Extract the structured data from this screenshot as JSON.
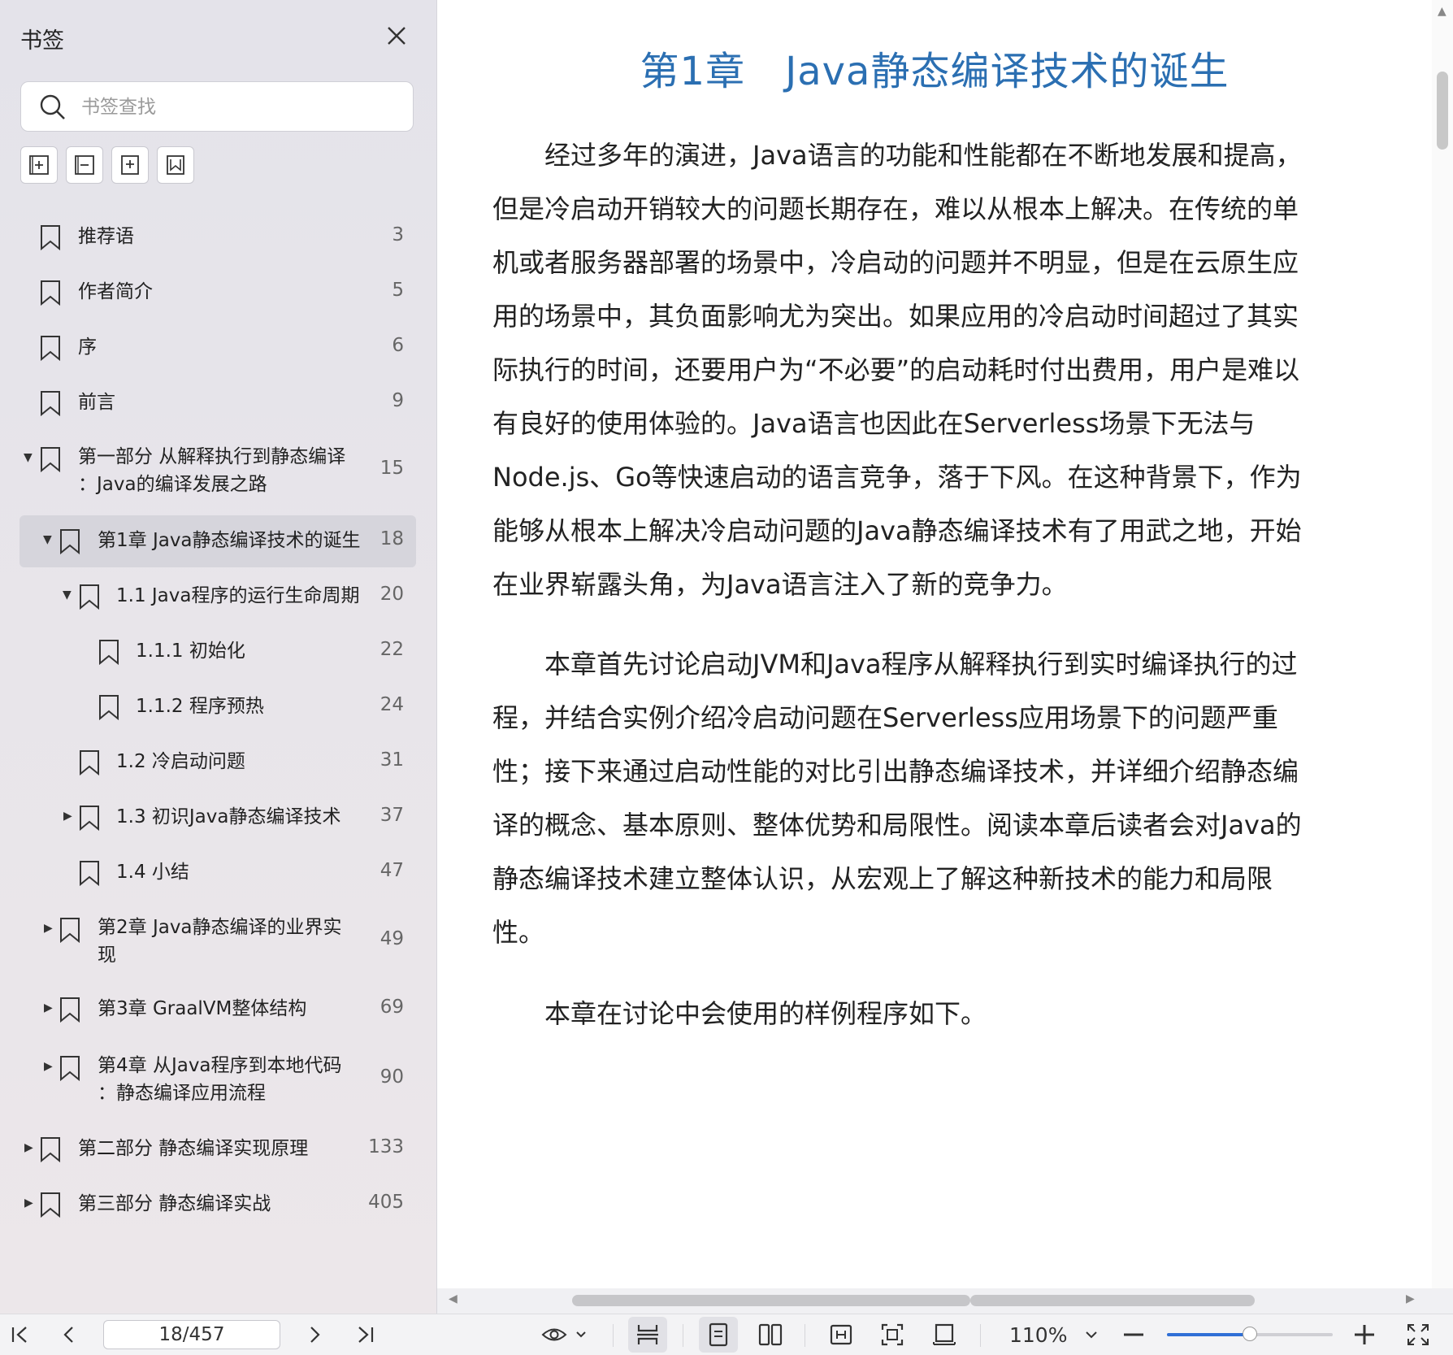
{
  "sidebar": {
    "title": "书签",
    "search_placeholder": "书签查找",
    "items": [
      {
        "label": "推荐语",
        "page": "3"
      },
      {
        "label": "作者简介",
        "page": "5"
      },
      {
        "label": "序",
        "page": "6"
      },
      {
        "label": "前言",
        "page": "9"
      },
      {
        "label_line1": "第一部分 从解释执行到静态编译",
        "label_line2": "：Java的编译发展之路",
        "page": "15"
      },
      {
        "label": "第1章 Java静态编译技术的诞生",
        "page": "18"
      },
      {
        "label": "1.1 Java程序的运行生命周期",
        "page": "20"
      },
      {
        "label": "1.1.1 初始化",
        "page": "22"
      },
      {
        "label": "1.1.2 程序预热",
        "page": "24"
      },
      {
        "label": "1.2 冷启动问题",
        "page": "31"
      },
      {
        "label": "1.3 初识Java静态编译技术",
        "page": "37"
      },
      {
        "label": "1.4 小结",
        "page": "47"
      },
      {
        "label_line1": "第2章 Java静态编译的业界实",
        "label_line2": "现",
        "page": "49"
      },
      {
        "label": "第3章 GraalVM整体结构",
        "page": "69"
      },
      {
        "label_line1": "第4章 从Java程序到本地代码",
        "label_line2": "：静态编译应用流程",
        "page": "90"
      },
      {
        "label": "第二部分 静态编译实现原理",
        "page": "133"
      },
      {
        "label": "第三部分 静态编译实战",
        "page": "405"
      }
    ]
  },
  "document": {
    "chapter_title": "第1章　Java静态编译技术的诞生",
    "paragraphs": [
      "经过多年的演进，Java语言的功能和性能都在不断地发展和提高，但是冷启动开销较大的问题长期存在，难以从根本上解决。在传统的单机或者服务器部署的场景中，冷启动的问题并不明显，但是在云原生应用的场景中，其负面影响尤为突出。如果应用的冷启动时间超过了其实际执行的时间，还要用户为“不必要”的启动耗时付出费用，用户是难以有良好的使用体验的。Java语言也因此在Serverless场景下无法与Node.js、Go等快速启动的语言竞争，落于下风。在这种背景下，作为能够从根本上解决冷启动问题的Java静态编译技术有了用武之地，开始在业界崭露头角，为Java语言注入了新的竞争力。",
      "本章首先讨论启动JVM和Java程序从解释执行到实时编译执行的过程，并结合实例介绍冷启动问题在Serverless应用场景下的问题严重性；接下来通过启动性能的对比引出静态编译技术，并详细介绍静态编译的概念、基本原则、整体优势和局限性。阅读本章后读者会对Java的静态编译技术建立整体认识，从宏观上了解这种新技术的能力和局限性。",
      "本章在讨论中会使用的样例程序如下。"
    ]
  },
  "bottombar": {
    "page_indicator": "18/457",
    "zoom": "110%",
    "zoom_slider_fraction": 0.5
  },
  "colors": {
    "accent": "#2b6fb2",
    "slider": "#2f6fd6"
  }
}
